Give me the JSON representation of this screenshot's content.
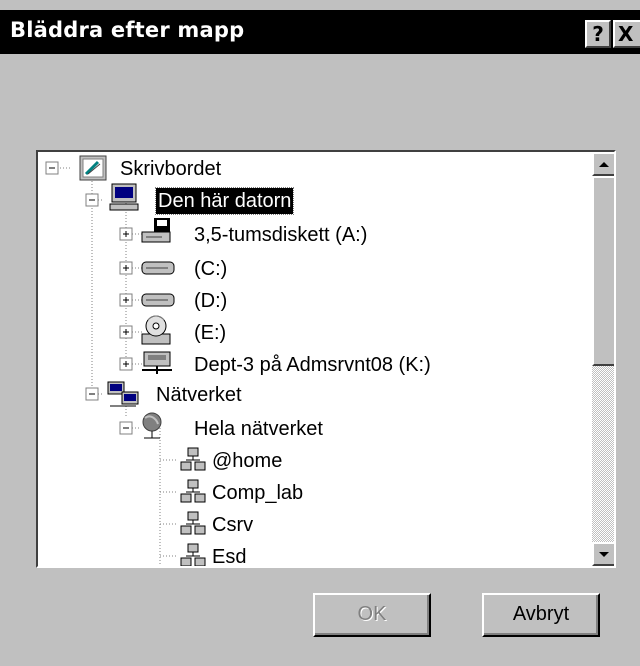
{
  "window": {
    "title": "Bläddra efter mapp",
    "help_label": "?",
    "close_label": "X",
    "colors": {
      "face": "#c0c0c0",
      "titlebar": "#000000",
      "title_text": "#ffffff"
    }
  },
  "tree": {
    "items": [
      {
        "label": "Skrivbordet",
        "icon": "desktop-icon",
        "expanded": true,
        "level": 0,
        "selected": false
      },
      {
        "label": "Den här datorn",
        "icon": "my-computer-icon",
        "expanded": true,
        "level": 1,
        "selected": true
      },
      {
        "label": "3,5-tumsdiskett (A:)",
        "icon": "floppy-drive-icon",
        "expanded": false,
        "level": 2,
        "selected": false
      },
      {
        "label": "(C:)",
        "icon": "hard-drive-icon",
        "expanded": false,
        "level": 2,
        "selected": false
      },
      {
        "label": "(D:)",
        "icon": "hard-drive-icon",
        "expanded": false,
        "level": 2,
        "selected": false
      },
      {
        "label": "(E:)",
        "icon": "cd-drive-icon",
        "expanded": false,
        "level": 2,
        "selected": false
      },
      {
        "label": "Dept-3 på Admsrvnt08 (K:)",
        "icon": "network-drive-icon",
        "expanded": false,
        "level": 2,
        "selected": false
      },
      {
        "label": "Nätverket",
        "icon": "network-neighborhood-icon",
        "expanded": true,
        "level": 1,
        "selected": false
      },
      {
        "label": "Hela nätverket",
        "icon": "entire-network-icon",
        "expanded": true,
        "level": 2,
        "selected": false
      },
      {
        "label": "@home",
        "icon": "workgroup-icon",
        "expanded": false,
        "level": 3,
        "selected": false
      },
      {
        "label": "Comp_lab",
        "icon": "workgroup-icon",
        "expanded": false,
        "level": 3,
        "selected": false
      },
      {
        "label": "Csrv",
        "icon": "workgroup-icon",
        "expanded": false,
        "level": 3,
        "selected": false
      },
      {
        "label": "Esd",
        "icon": "workgroup-icon",
        "expanded": false,
        "level": 3,
        "selected": false
      }
    ],
    "scrollbar": {
      "up_icon": "scroll-up-arrow-icon",
      "down_icon": "scroll-down-arrow-icon"
    }
  },
  "buttons": {
    "ok_label": "OK",
    "ok_enabled": false,
    "cancel_label": "Avbryt"
  }
}
